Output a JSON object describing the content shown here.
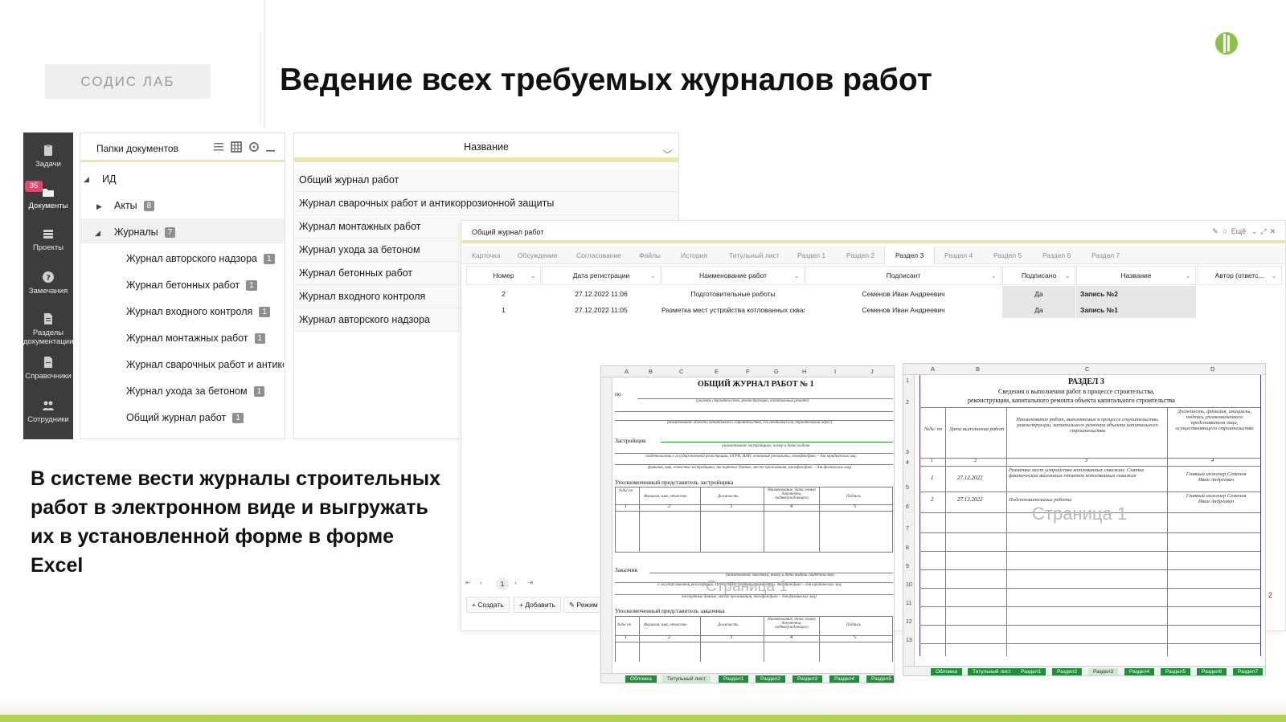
{
  "brand": "СОДИС ЛАБ",
  "slide_title": "Ведение всех требуемых журналов работ",
  "caption": "В системе вести журналы строительных работ в электронном виде и выгружать их в установленной форме в форме Excel",
  "sidebar": {
    "items": [
      {
        "label": "Задачи",
        "icon": "clipboard-icon"
      },
      {
        "label": "Документы",
        "icon": "folder-icon",
        "badge": "35"
      },
      {
        "label": "Проекты",
        "icon": "projects-icon"
      },
      {
        "label": "Замечания",
        "icon": "question-icon"
      },
      {
        "label": "Разделы документации",
        "icon": "document-icon"
      },
      {
        "label": "Справочники",
        "icon": "book-icon"
      },
      {
        "label": "Сотрудники",
        "icon": "users-icon"
      }
    ]
  },
  "folders": {
    "title": "Папки документов",
    "root": "ИД",
    "acts": {
      "label": "Акты",
      "count": "8"
    },
    "journals": {
      "label": "Журналы",
      "count": "7"
    },
    "items": [
      {
        "label": "Журнал авторского надзора",
        "count": "1"
      },
      {
        "label": "Журнал бетонных работ",
        "count": "1"
      },
      {
        "label": "Журнал входного контроля",
        "count": "1"
      },
      {
        "label": "Журнал монтажных работ",
        "count": "1"
      },
      {
        "label": "Журнал сварочных работ и антикорр",
        "count": ""
      },
      {
        "label": "Журнал ухода за бетоном",
        "count": "1"
      },
      {
        "label": "Общий журнал работ",
        "count": "1"
      }
    ]
  },
  "names": {
    "header": "Название",
    "rows": [
      "Общий журнал работ",
      "Журнал сварочных работ и антикоррозионной защиты",
      "Журнал монтажных работ",
      "Журнал ухода за бетоном",
      "Журнал бетонных работ",
      "Журнал входного контроля",
      "Журнал авторского надзора"
    ]
  },
  "detail": {
    "title": "Общий журнал работ",
    "more": "Ещё",
    "tabs": [
      "Карточка",
      "Обсуждение",
      "Согласование",
      "Файлы",
      "История",
      "Титульный лист",
      "Раздел 1",
      "Раздел 2",
      "Раздел 3",
      "Раздел 4",
      "Раздел 5",
      "Раздел 6",
      "Раздел 7"
    ],
    "active_tab": "Раздел 3",
    "columns": [
      "Номер",
      "Дата регистрации",
      "Наименование работ",
      "Подписант",
      "Подписано",
      "Название",
      "Автор (ответс..."
    ],
    "rows": [
      [
        "2",
        "27.12.2022 11:06",
        "Подготовительные работы",
        "Семенов Иван Андреевич",
        "Да",
        "Запись №2",
        ""
      ],
      [
        "1",
        "27.12.2022 11:05",
        "Разметка мест устройства котлованных скважин",
        "Семенов Иван Андреевич",
        "Да",
        "Запись №1",
        ""
      ]
    ],
    "page": "1",
    "create_label": "Создать",
    "add_label": "Добавить",
    "mode_label": "Режим"
  },
  "sheet1": {
    "cols": [
      "A",
      "B",
      "C",
      "E",
      "F",
      "G",
      "H",
      "I",
      "J"
    ],
    "title": "ОБЩИЙ ЖУРНАЛ РАБОТ № 1",
    "po": "по",
    "developer": "Застройщик",
    "dev_rep": "Уполномоченный представитель застройщика",
    "customer": "Заказчик",
    "cust_rep": "Уполномоченный представитель заказчика",
    "hints": [
      "(указать строительство, реконструкцию, капитальный ремонт)",
      "(наименование объекта капитального строительства, его почтовый или строительный адрес)",
      "(наименование застройщика, номер и дата выдачи",
      "свидетельства о государственной регистрации, ОГРН, ИНН, почтовые реквизиты, телефон/факс – для юридических лиц;",
      "фамилия, имя, отчество застройщика, паспортные данные, место проживания, телефон/факс – для физических лиц)",
      "(наименование заказчика, номер и дата выдачи свидетельства",
      "о государственной регистрации, ОГРН, ИНН, почтовые реквизиты, телефон/факс – для юридических лиц;",
      "паспортные данные, место проживания, телефон/факс – для физических лиц)"
    ],
    "table_head": [
      "№№/ пп",
      "Фамилия, имя, отчество",
      "Должность",
      "Наименование, дата, номер документа, подтверждающего",
      "Подпись"
    ],
    "table_head2": [
      "№№/ пп",
      "Фамилия, имя, отчество",
      "Должность",
      "Наименование, дата, номер документа, подтверждающего",
      "Подпись"
    ],
    "nums": [
      "1",
      "2",
      "3",
      "4",
      "5"
    ],
    "watermark": "Страница 1",
    "tabs": [
      "Обложка",
      "Титульный лист",
      "Раздел1",
      "Раздел2",
      "Раздел3",
      "Раздел4",
      "Раздел5"
    ]
  },
  "sheet2": {
    "cols": [
      "A",
      "B",
      "C",
      "D"
    ],
    "title": "РАЗДЕЛ 3",
    "subtitle1": "Сведения о выполнении работ в процессе строительства,",
    "subtitle2": "реконструкции, капитального ремонта объекта капитального строительства",
    "head": [
      "№№/ пп",
      "Дата выполнения работ",
      "Наименование работ, выполняемых в процессе строительства, реконструкции, капитального ремонта объекта капитального строительства",
      "Должность, фамилия, инициалы, подпись уполномоченного представителя лица, осуществляющего строительство"
    ],
    "nums": [
      "1",
      "2",
      "3",
      "4"
    ],
    "rows": [
      [
        "1",
        "27.12.2022",
        "Разметка мест устройства котлованных скважин; Снятие фактических высотных отметок котлованных скважин",
        "Главный инженер Семенов Иван Андреевич"
      ],
      [
        "2",
        "27.12.2022",
        "Подготовительные работы",
        "Главный инженер Семенов Иван Андреевич"
      ]
    ],
    "watermark": "Страница 1",
    "side_num": "2",
    "tabs": [
      "Обложка",
      "Титульный лист",
      "Раздел1",
      "Раздел2",
      "Раздел3",
      "Раздел4",
      "Раздел5",
      "Раздел6",
      "Раздел7"
    ],
    "current_tab": "Раздел3"
  },
  "colors": {
    "accent_yellow": "#ece7a8",
    "sidebar_bg": "#3c3c3c",
    "badge": "#e5476c",
    "excel_tab": "#1f8f3a",
    "footer": "#b6cf57",
    "logo": "#8bc34a"
  }
}
